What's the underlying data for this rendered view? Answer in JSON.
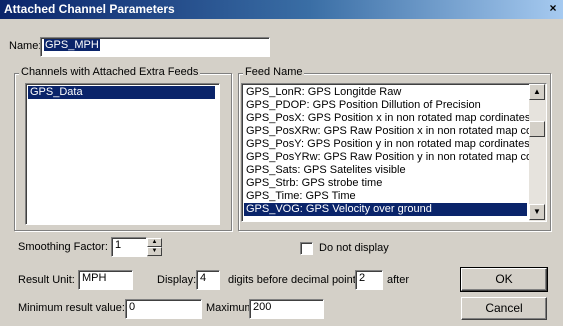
{
  "window": {
    "title": "Attached Channel Parameters",
    "close_glyph": "×"
  },
  "name_field": {
    "label": "Name:",
    "value": "GPS_MPH"
  },
  "channels_group": {
    "label": "Channels with Attached Extra Feeds",
    "items": [
      {
        "label": "GPS_Data",
        "selected": true
      }
    ]
  },
  "feed_group": {
    "label": "Feed Name",
    "items": [
      {
        "label": "GPS_LonR: GPS Longitde Raw"
      },
      {
        "label": "GPS_PDOP: GPS Position Dillution of Precision"
      },
      {
        "label": "GPS_PosX: GPS Position x in non rotated map cordinates"
      },
      {
        "label": "GPS_PosXRw: GPS Raw Position x in non rotated map corc"
      },
      {
        "label": "GPS_PosY: GPS Position y in non rotated map cordinates"
      },
      {
        "label": "GPS_PosYRw: GPS Raw Position y in non rotated map corc"
      },
      {
        "label": "GPS_Sats: GPS Satelites visible"
      },
      {
        "label": "GPS_Strb: GPS strobe time"
      },
      {
        "label": "GPS_Time: GPS Time"
      },
      {
        "label": "GPS_VOG: GPS Velocity over ground",
        "selected": true
      }
    ]
  },
  "smoothing": {
    "label": "Smoothing Factor:",
    "value": "1"
  },
  "do_not_display": {
    "label": "Do not display",
    "checked": false
  },
  "result_unit": {
    "label": "Result Unit:",
    "value": "MPH"
  },
  "display": {
    "label": "Display:",
    "digits_value": "4",
    "digits_label": "digits before decimal point,",
    "after_value": "2",
    "after_label": "after"
  },
  "min_result": {
    "label": "Minimum result value:",
    "value": "0"
  },
  "maximum": {
    "label": "Maximum:",
    "value": "200"
  },
  "buttons": {
    "ok": "OK",
    "cancel": "Cancel"
  },
  "icons": {
    "scroll_up": "up-arrow-icon",
    "scroll_down": "down-arrow-icon"
  }
}
